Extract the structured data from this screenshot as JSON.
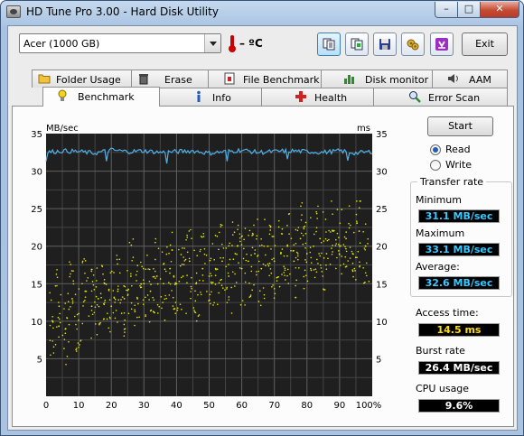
{
  "window": {
    "title": "HD Tune Pro 3.00 - Hard Disk Utility",
    "minimize_glyph": "–",
    "maximize_glyph": "□",
    "close_glyph": "✕"
  },
  "toolbar": {
    "drive": "Acer (1000 GB)",
    "temperature": "– ºC",
    "buttons": [
      "copy-text-icon",
      "copy-screenshot-icon",
      "save-icon",
      "options-icon",
      "download-icon"
    ],
    "exit_label": "Exit"
  },
  "tabs_row1": [
    "Folder Usage",
    "Erase",
    "File Benchmark",
    "Disk monitor",
    "AAM"
  ],
  "tabs_row2": [
    "Benchmark",
    "Info",
    "Health",
    "Error Scan"
  ],
  "selected_tab": "Benchmark",
  "chart": {
    "unit_left": "MB/sec",
    "unit_right": "ms",
    "y_ticks": [
      "35",
      "30",
      "25",
      "20",
      "15",
      "10",
      "5"
    ],
    "y_ticks_right": [
      "35",
      "30",
      "25",
      "20",
      "15",
      "10",
      "5"
    ],
    "x_ticks": [
      "0",
      "10",
      "20",
      "30",
      "40",
      "50",
      "60",
      "70",
      "80",
      "90",
      "100%"
    ]
  },
  "chart_data": {
    "type": "line",
    "ylabel": "MB/sec",
    "y2label": "ms",
    "xlim": [
      0,
      100
    ],
    "ylim": [
      0,
      35
    ],
    "y2lim": [
      0,
      35
    ],
    "grid": true,
    "series": [
      {
        "color": "#4fb1ea",
        "x": [
          0,
          5,
          10,
          15,
          20,
          25,
          30,
          35,
          40,
          45,
          50,
          55,
          60,
          65,
          70,
          75,
          80,
          85,
          90,
          95,
          100
        ],
        "values": [
          32.5,
          32.7,
          32.6,
          32.4,
          32.8,
          32.6,
          32.7,
          32.5,
          32.6,
          32.7,
          32.4,
          32.6,
          32.8,
          32.5,
          32.6,
          32.7,
          32.6,
          32.5,
          32.7,
          32.4,
          32.6
        ]
      },
      {
        "type": "scatter",
        "color": "#e8e800",
        "x": [
          2,
          4,
          6,
          8,
          10,
          12,
          14,
          16,
          18,
          20,
          22,
          24,
          26,
          28,
          30,
          32,
          34,
          36,
          38,
          40,
          42,
          44,
          46,
          48,
          50,
          52,
          54,
          56,
          58,
          60,
          62,
          64,
          66,
          68,
          70,
          72,
          74,
          76,
          78,
          80,
          82,
          84,
          86,
          88,
          90,
          92,
          94,
          96,
          98
        ],
        "values": [
          10,
          12,
          9,
          13,
          11,
          14,
          12,
          13,
          15,
          12,
          14,
          13,
          16,
          13,
          15,
          14,
          16,
          15,
          17,
          15,
          16,
          18,
          15,
          17,
          16,
          17,
          18,
          16,
          19,
          17,
          18,
          19,
          17,
          20,
          18,
          19,
          20,
          18,
          21,
          19,
          20,
          21,
          19,
          22,
          20,
          21,
          19,
          22,
          20
        ]
      }
    ]
  },
  "controls": {
    "start_label": "Start",
    "read_label": "Read",
    "write_label": "Write",
    "read_selected": true
  },
  "stats": {
    "transfer_rate_title": "Transfer rate",
    "minimum_label": "Minimum",
    "minimum_value": "31.1 MB/sec",
    "maximum_label": "Maximum",
    "maximum_value": "33.1 MB/sec",
    "average_label": "Average:",
    "average_value": "32.6 MB/sec",
    "access_time_label": "Access time:",
    "access_time_value": "14.5 ms",
    "burst_rate_label": "Burst rate",
    "burst_rate_value": "26.4 MB/sec",
    "cpu_usage_label": "CPU usage",
    "cpu_usage_value": "9.6%"
  },
  "colors": {
    "plot_bg": "#1f1f1f",
    "grid": "#555555",
    "read_line": "#4fb1ea",
    "access_points": "#e8e800",
    "minimum_text": "#37c8ff",
    "access_text": "#ffe000"
  }
}
